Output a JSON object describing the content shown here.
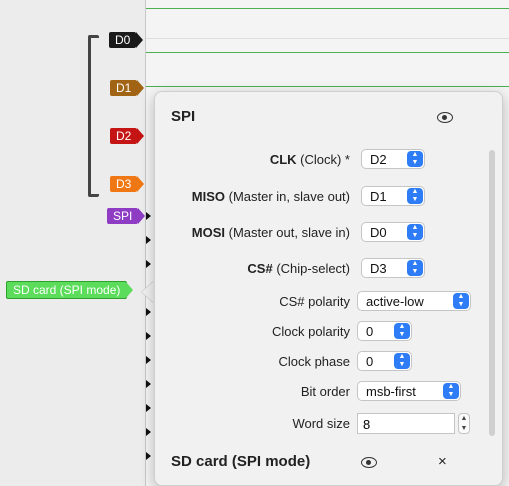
{
  "channels": {
    "d0": {
      "label": "D0",
      "color": "#1a1a1a"
    },
    "d1": {
      "label": "D1",
      "color": "#a06414"
    },
    "d2": {
      "label": "D2",
      "color": "#c41414"
    },
    "d3": {
      "label": "D3",
      "color": "#f07814"
    }
  },
  "decoders": {
    "spi": {
      "label": "SPI",
      "color": "#8e3cc4"
    },
    "sdcard": {
      "label": "SD card (SPI mode)",
      "color": "#5bdc5b"
    }
  },
  "popover": {
    "title": "SPI",
    "rows": [
      {
        "bold": "CLK",
        "rest": " (Clock) *",
        "value": "D2"
      },
      {
        "bold": "MISO",
        "rest": " (Master in, slave out)",
        "value": "D1"
      },
      {
        "bold": "MOSI",
        "rest": " (Master out, slave in)",
        "value": "D0"
      },
      {
        "bold": "CS#",
        "rest": " (Chip-select)",
        "value": "D3"
      }
    ],
    "options": {
      "cs_polarity": {
        "label": "CS# polarity",
        "value": "active-low"
      },
      "clock_polarity": {
        "label": "Clock polarity",
        "value": "0"
      },
      "clock_phase": {
        "label": "Clock phase",
        "value": "0"
      },
      "bit_order": {
        "label": "Bit order",
        "value": "msb-first"
      },
      "word_size": {
        "label": "Word size",
        "value": "8"
      }
    },
    "footer_title": "SD card (SPI mode)",
    "close_glyph": "×"
  }
}
